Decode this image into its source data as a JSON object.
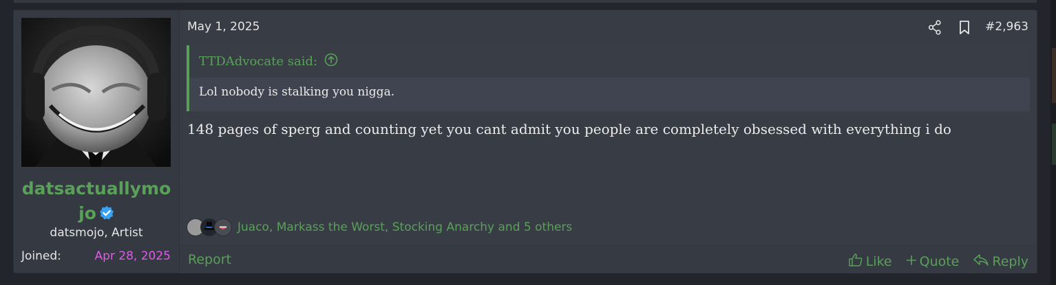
{
  "user": {
    "username_line1": "datsactuallymo",
    "username_line2": "jo",
    "title": "datsmojo, Artist",
    "joined_label": "Joined:",
    "joined_date": "Apr 28, 2025",
    "verified_icon": "verified-check-icon"
  },
  "post": {
    "date": "May 1, 2025",
    "number": "#2,963",
    "share_icon": "share-icon",
    "bookmark_icon": "bookmark-icon",
    "quote": {
      "author_said": "TTDAdvocate said:",
      "text": "Lol nobody is stalking you nigga."
    },
    "message": "148 pages of sperg and counting yet you cant admit you people are completely obsessed with everything i do",
    "reactions_text": "Juaco, Markass the Worst, Stocking Anarchy and 5 others"
  },
  "footer": {
    "report": "Report",
    "like": "Like",
    "quote": "Quote",
    "reply": "Reply"
  },
  "colors": {
    "accent_green": "#5aa05a",
    "joined_date_pink": "#e15ae9",
    "verified_blue": "#3aa0f0",
    "post_bg": "#383c45"
  }
}
